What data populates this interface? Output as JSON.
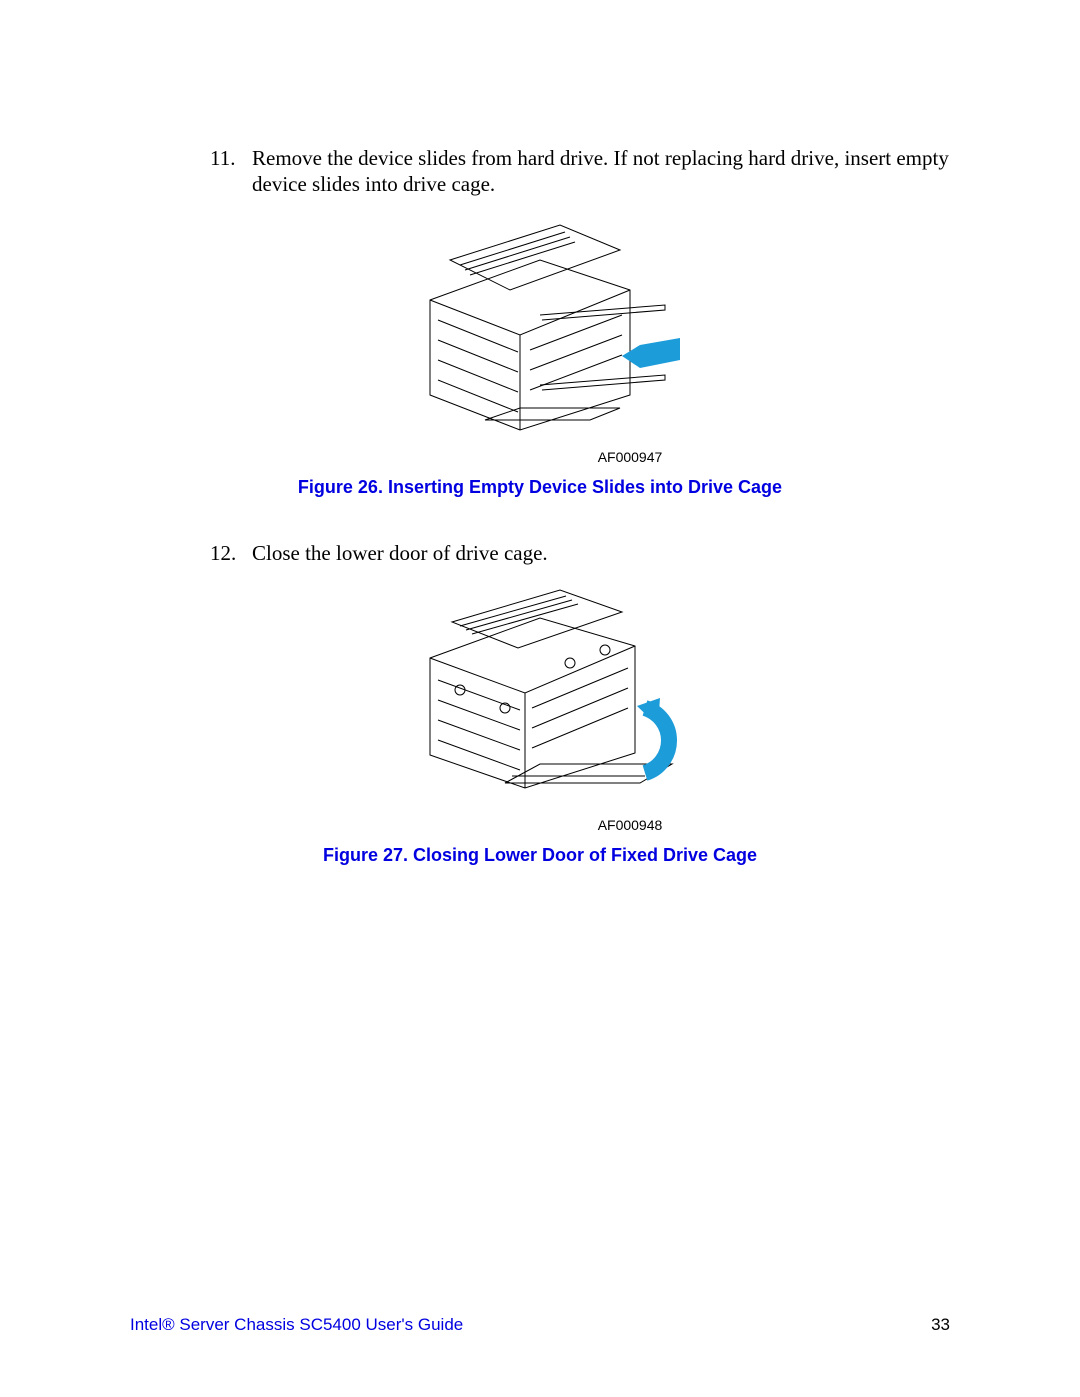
{
  "steps": {
    "s11": {
      "num": "11.",
      "text": "Remove the device slides from hard drive. If not replacing hard drive, insert empty device slides into drive cage."
    },
    "s12": {
      "num": "12.",
      "text": "Close the lower door of drive cage."
    }
  },
  "figures": {
    "f26": {
      "ref": "AF000947",
      "caption": "Figure 26. Inserting Empty Device Slides into Drive Cage"
    },
    "f27": {
      "ref": "AF000948",
      "caption": "Figure 27. Closing Lower Door of Fixed Drive Cage"
    }
  },
  "footer": {
    "title": "Intel® Server Chassis SC5400 User's Guide",
    "page": "33"
  }
}
